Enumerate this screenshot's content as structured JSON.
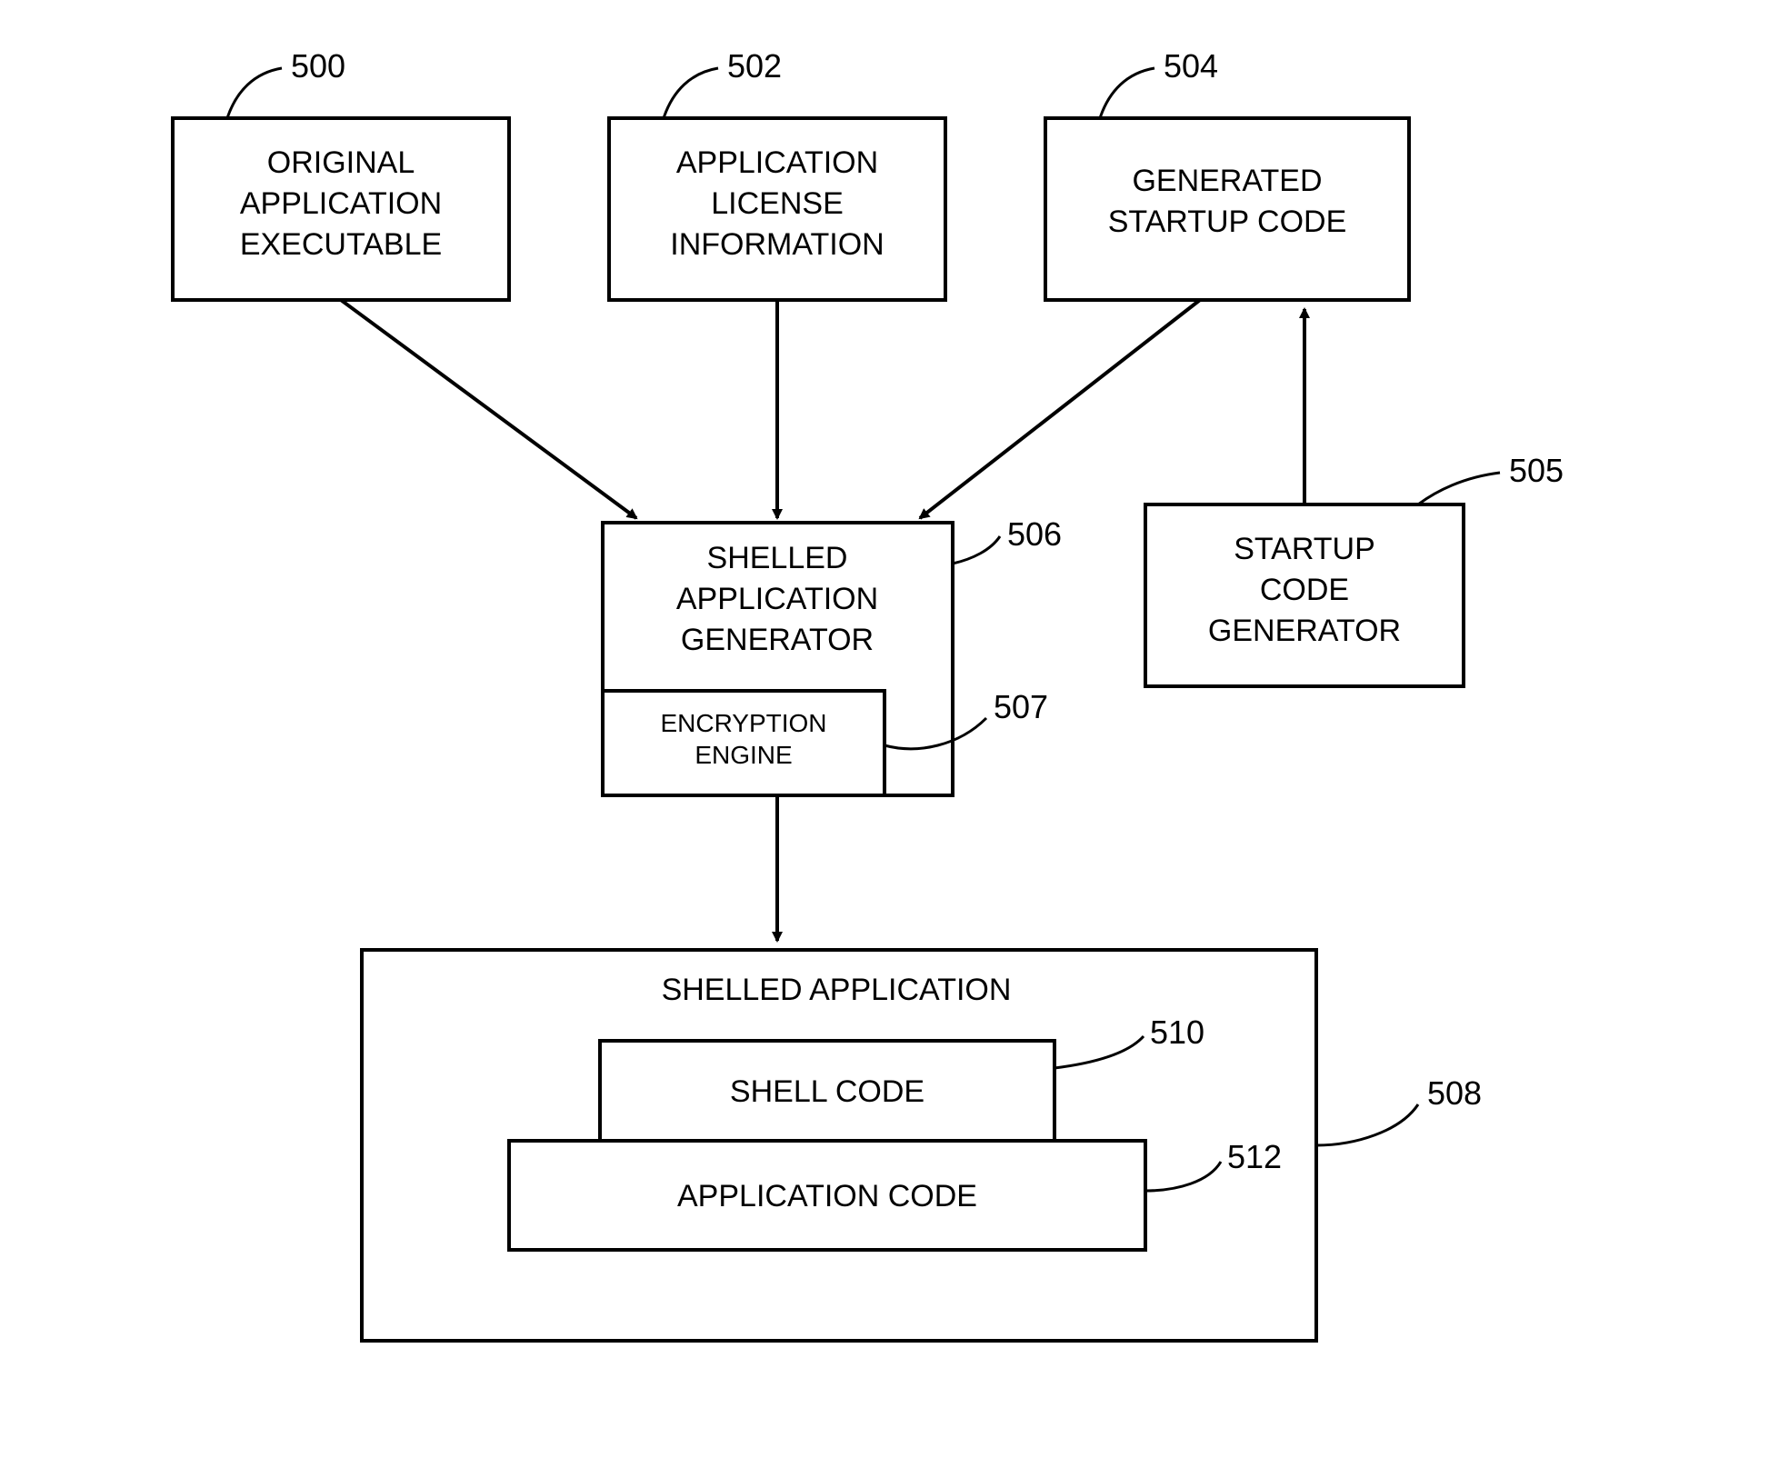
{
  "nodes": {
    "n500": {
      "ref": "500",
      "l1": "ORIGINAL",
      "l2": "APPLICATION",
      "l3": "EXECUTABLE"
    },
    "n502": {
      "ref": "502",
      "l1": "APPLICATION",
      "l2": "LICENSE",
      "l3": "INFORMATION"
    },
    "n504": {
      "ref": "504",
      "l1": "GENERATED",
      "l2": "STARTUP CODE"
    },
    "n505": {
      "ref": "505",
      "l1": "STARTUP",
      "l2": "CODE",
      "l3": "GENERATOR"
    },
    "n506": {
      "ref": "506",
      "l1": "SHELLED",
      "l2": "APPLICATION",
      "l3": "GENERATOR"
    },
    "n507": {
      "ref": "507",
      "l1": "ENCRYPTION",
      "l2": "ENGINE"
    },
    "n508": {
      "ref": "508",
      "l1": "SHELLED APPLICATION"
    },
    "n510": {
      "ref": "510",
      "l1": "SHELL CODE"
    },
    "n512": {
      "ref": "512",
      "l1": "APPLICATION CODE"
    }
  }
}
